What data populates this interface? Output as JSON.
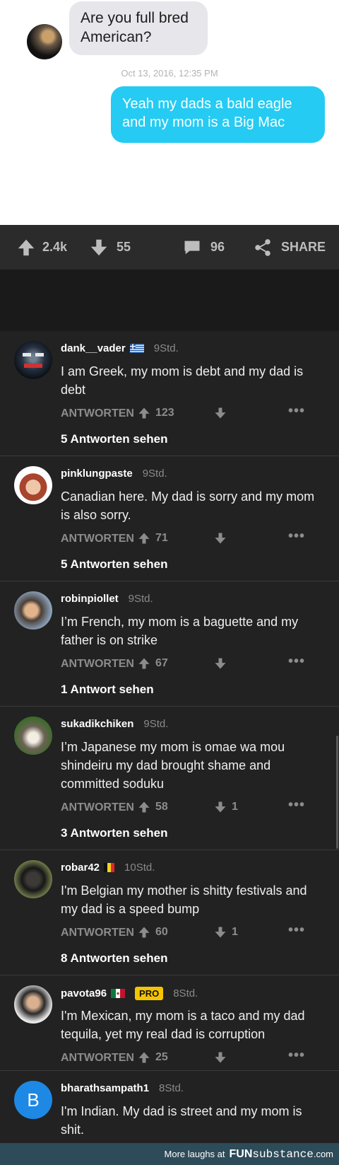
{
  "imessage": {
    "incoming_text": "Are you full bred American?",
    "timestamp": "Oct 13, 2016, 12:35 PM",
    "outgoing_text": "Yeah my dads a bald eagle and my mom is a Big Mac"
  },
  "actionbar": {
    "upvotes": "2.4k",
    "downvotes": "55",
    "comments": "96",
    "share_label": "SHARE"
  },
  "comments": [
    {
      "user": "dank__vader",
      "time": "9Std.",
      "text": "I am Greek, my mom is debt and my dad is debt",
      "reply_label": "ANTWORTEN",
      "upvotes": "123",
      "downvotes": "",
      "replies": "5 Antworten sehen"
    },
    {
      "user": "pinklungpaste",
      "time": "9Std.",
      "text": "Canadian here. My dad is sorry and my mom is also sorry.",
      "reply_label": "ANTWORTEN",
      "upvotes": "71",
      "downvotes": "",
      "replies": "5 Antworten sehen"
    },
    {
      "user": "robinpiollet",
      "time": "9Std.",
      "text": "I’m French, my mom is a baguette and my father is on strike",
      "reply_label": "ANTWORTEN",
      "upvotes": "67",
      "downvotes": "",
      "replies": "1 Antwort sehen"
    },
    {
      "user": "sukadikchiken",
      "time": "9Std.",
      "text": "I’m Japanese my mom is omae wa mou shindeiru my dad brought shame and committed soduku",
      "reply_label": "ANTWORTEN",
      "upvotes": "58",
      "downvotes": "1",
      "replies": "3 Antworten sehen"
    },
    {
      "user": "robar42",
      "time": "10Std.",
      "text": "I'm Belgian my mother is shitty festivals and my dad is a speed bump",
      "reply_label": "ANTWORTEN",
      "upvotes": "60",
      "downvotes": "1",
      "replies": "8 Antworten sehen"
    },
    {
      "user": "pavota96",
      "pro_badge": "PRO",
      "time": "8Std.",
      "text": "I'm Mexican, my mom is a taco and my dad tequila, yet my real dad is corruption",
      "reply_label": "ANTWORTEN",
      "upvotes": "25",
      "downvotes": ""
    },
    {
      "user": "bharathsampath1",
      "avatar_letter": "B",
      "time": "8Std.",
      "text": "I'm Indian. My dad is street and my mom is shit."
    }
  ],
  "footer": {
    "prefix": "More laughs at",
    "brand_fun": "FUN",
    "brand_sub": "substance",
    "brand_tld": ".com"
  },
  "colors": {
    "outgoing_bubble": "#25cbf2",
    "incoming_bubble": "#e6e6eb",
    "comments_bg": "#222222",
    "pro_badge": "#f5c400",
    "footer_bg": "#2d4b58"
  },
  "icons": [
    "upvote-arrow-icon",
    "downvote-arrow-icon",
    "comment-bubble-icon",
    "share-icon",
    "more-dots-icon"
  ]
}
